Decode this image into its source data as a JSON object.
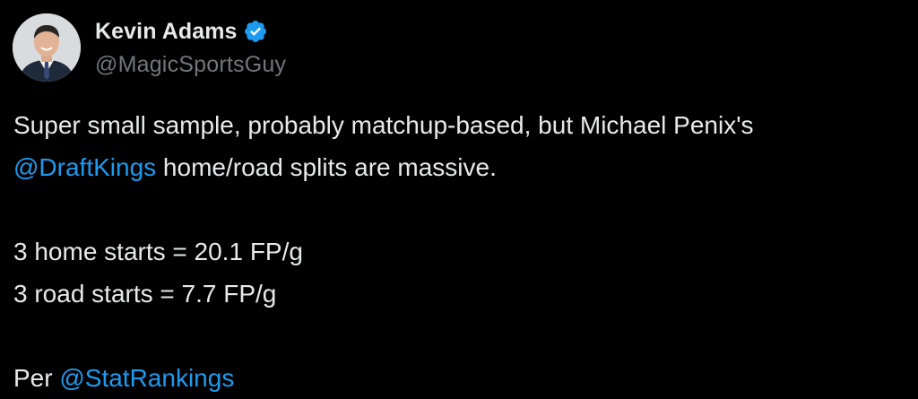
{
  "author": {
    "display_name": "Kevin Adams",
    "handle": "@MagicSportsGuy",
    "verified": true
  },
  "tweet": {
    "line1": "Super small sample, probably matchup-based, but Michael Penix's",
    "line2_mention": "@DraftKings",
    "line2_text": " home/road splits are massive.",
    "stat_home": "3 home starts = 20.1 FP/g",
    "stat_road": "3 road starts = 7.7 FP/g",
    "source_prefix": "Per ",
    "source_mention": "@StatRankings"
  },
  "colors": {
    "background": "#000000",
    "text": "#e7e9ea",
    "handle": "#71767b",
    "link": "#1d9bf0",
    "verified": "#1d9bf0"
  },
  "icons": {
    "verified": "verified-badge-icon",
    "avatar": "profile-avatar"
  }
}
